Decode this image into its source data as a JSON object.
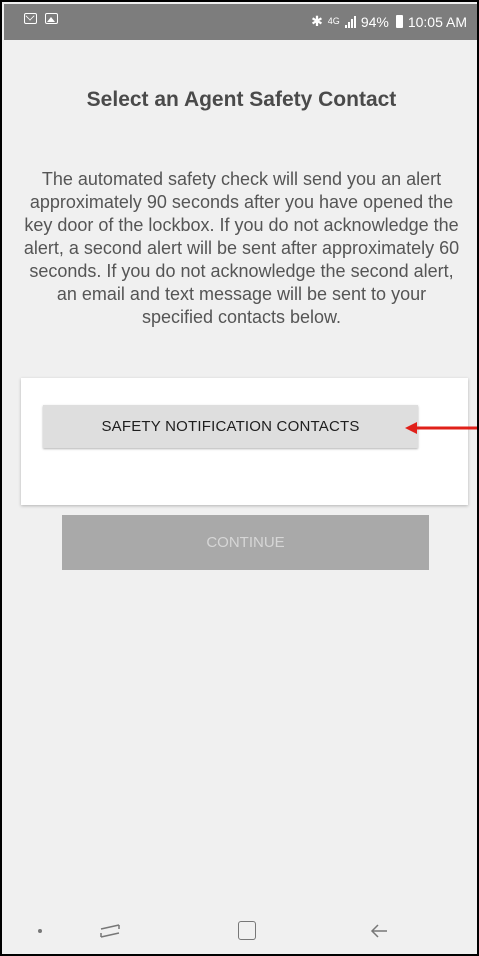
{
  "status_bar": {
    "left_icons": [
      "mail-icon",
      "image-icon"
    ],
    "bluetooth_glyph": "∦",
    "network": "4G",
    "battery": "94%",
    "time": "10:05 AM"
  },
  "page": {
    "title": "Select an Agent Safety Contact",
    "description": "The automated safety check will send you an alert approximately 90 seconds after you have opened the key door of the lockbox. If you do not acknowledge the alert, a second alert will be sent after approximately 60 seconds. If you do not acknowledge the second alert, an email and text message will be sent to your specified contacts below."
  },
  "buttons": {
    "contacts_label": "SAFETY NOTIFICATION CONTACTS",
    "continue_label": "CONTINUE"
  },
  "annotation": {
    "arrow_color": "#e0201a"
  },
  "nav_bar": {
    "icons": [
      "dot-icon",
      "recent-apps-icon",
      "home-icon",
      "back-icon"
    ]
  },
  "colors": {
    "background": "#f0f0f0",
    "status_bar": "#7d7d7d",
    "continue_disabled": "#a9a9a9"
  }
}
